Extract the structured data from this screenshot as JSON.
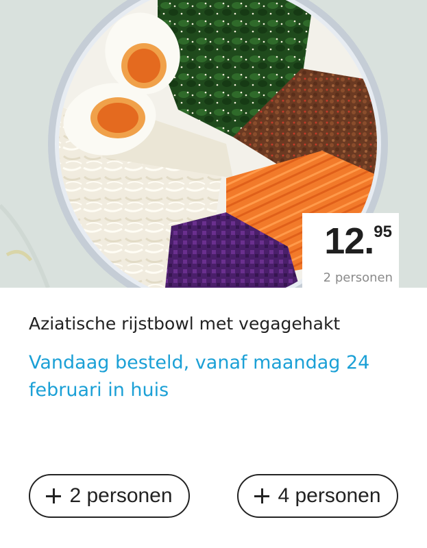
{
  "product": {
    "image_alt": "Aziatische rijstbowl met vegagehakt",
    "title": "Aziatische rijstbowl met vegagehakt",
    "delivery": "Vandaag besteld, vanaf maandag 24 februari in huis"
  },
  "price": {
    "integer": "12.",
    "decimals": "95",
    "unit": "2 personen"
  },
  "options": [
    {
      "label": "2 personen",
      "icon": "plus-icon"
    },
    {
      "label": "4 personen",
      "icon": "plus-icon"
    }
  ],
  "colors": {
    "delivery_text": "#1ba0d6",
    "title_text": "#222222",
    "price_text": "#1f1f1f",
    "price_unit": "#8a8a8a",
    "button_border": "#222222"
  }
}
